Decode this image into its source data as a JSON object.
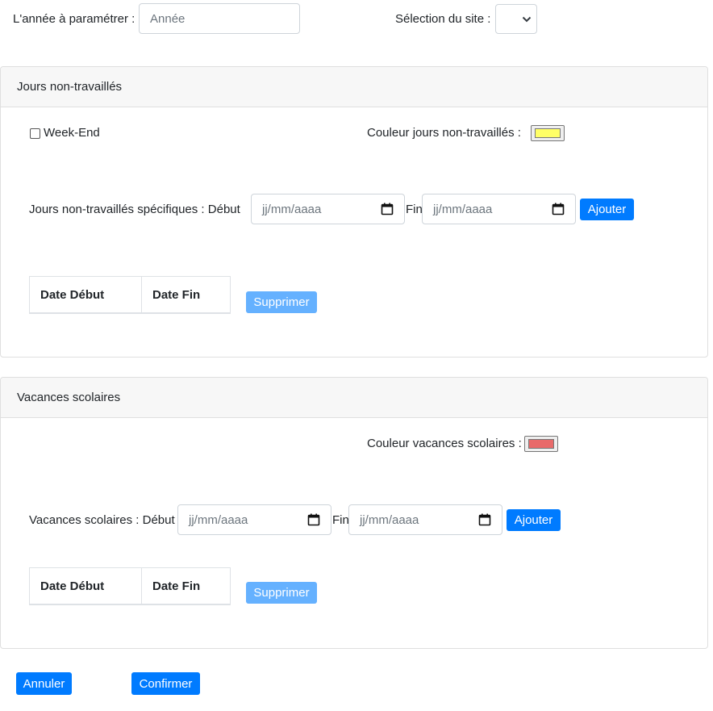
{
  "top": {
    "year_label": "L'année à paramétrer :",
    "year_placeholder": "Année",
    "site_label": "Sélection du site :",
    "site_value": ""
  },
  "non_worked": {
    "header": "Jours non-travaillés",
    "weekend_label": "Week-End",
    "weekend_checked": false,
    "color_label": "Couleur jours non-travaillés :",
    "color_value": "#ffff66",
    "specific_label": "Jours non-travaillés spécifiques : Début",
    "start_placeholder": "jj/mm/aaaa",
    "end_label": "Fin",
    "end_placeholder": "jj/mm/aaaa",
    "add_button": "Ajouter",
    "table_headers": [
      "Date Début",
      "Date Fin"
    ],
    "delete_button": "Supprimer"
  },
  "holidays": {
    "header": "Vacances scolaires",
    "color_label": "Couleur vacances scolaires :",
    "color_value": "#e86a6a",
    "range_label": "Vacances scolaires : Début",
    "start_placeholder": "jj/mm/aaaa",
    "end_label": "Fin",
    "end_placeholder": "jj/mm/aaaa",
    "add_button": "Ajouter",
    "table_headers": [
      "Date Début",
      "Date Fin"
    ],
    "delete_button": "Supprimer"
  },
  "footer": {
    "cancel_button": "Annuler",
    "confirm_button": "Confirmer"
  },
  "colors": {
    "primary": "#007bff",
    "primary_disabled": "#65b1ff"
  }
}
